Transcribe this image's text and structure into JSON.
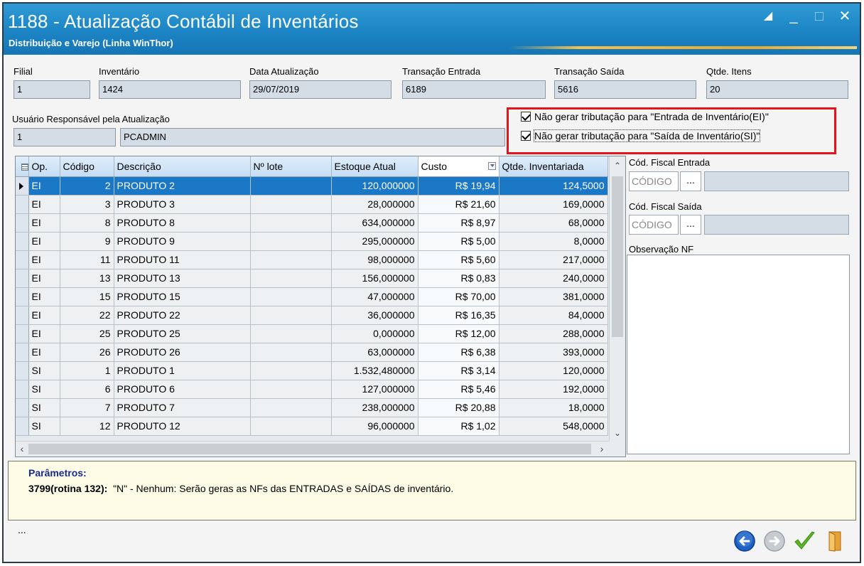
{
  "window": {
    "title": "1188 - Atualização Contábil de Inventários",
    "subtitle": "Distribuição e Varejo (Linha WinThor)",
    "controls": [
      "restore",
      "minimize",
      "maximize",
      "close"
    ]
  },
  "header_fields": {
    "filial": {
      "label": "Filial",
      "value": "1"
    },
    "inventario": {
      "label": "Inventário",
      "value": "1424"
    },
    "data_atualizacao": {
      "label": "Data Atualização",
      "value": "29/07/2019"
    },
    "transacao_entrada": {
      "label": "Transação Entrada",
      "value": "6189"
    },
    "transacao_saida": {
      "label": "Transação Saída",
      "value": "5616"
    },
    "qtde_itens": {
      "label": "Qtde. Itens",
      "value": "20"
    },
    "usuario": {
      "label": "Usuário Responsável pela Atualização",
      "code": "1",
      "name": "PCADMIN"
    }
  },
  "options": {
    "nao_gerar_ei": {
      "label": "Não gerar tributação para \"Entrada de Inventário(EI)\"",
      "checked": true
    },
    "nao_gerar_si": {
      "label": "Não gerar tributação para \"Saída de Inventário(SI)\"",
      "checked": true
    }
  },
  "grid": {
    "columns": [
      "Op.",
      "Código",
      "Descrição",
      "Nº lote",
      "Estoque Atual",
      "Custo",
      "Qtde. Inventariada"
    ],
    "rows": [
      {
        "op": "EI",
        "codigo": "2",
        "descricao": "PRODUTO 2",
        "lote": "",
        "estoque": "120,000000",
        "custo": "R$ 19,94",
        "qtde": "124,5000",
        "selected": true
      },
      {
        "op": "EI",
        "codigo": "3",
        "descricao": "PRODUTO 3",
        "lote": "",
        "estoque": "28,000000",
        "custo": "R$ 21,60",
        "qtde": "169,0000"
      },
      {
        "op": "EI",
        "codigo": "8",
        "descricao": "PRODUTO 8",
        "lote": "",
        "estoque": "634,000000",
        "custo": "R$ 8,97",
        "qtde": "68,0000"
      },
      {
        "op": "EI",
        "codigo": "9",
        "descricao": "PRODUTO 9",
        "lote": "",
        "estoque": "295,000000",
        "custo": "R$ 5,00",
        "qtde": "8,0000"
      },
      {
        "op": "EI",
        "codigo": "11",
        "descricao": "PRODUTO 11",
        "lote": "",
        "estoque": "98,000000",
        "custo": "R$ 5,60",
        "qtde": "217,0000"
      },
      {
        "op": "EI",
        "codigo": "13",
        "descricao": "PRODUTO 13",
        "lote": "",
        "estoque": "156,000000",
        "custo": "R$ 0,83",
        "qtde": "240,0000"
      },
      {
        "op": "EI",
        "codigo": "15",
        "descricao": "PRODUTO 15",
        "lote": "",
        "estoque": "47,000000",
        "custo": "R$ 70,00",
        "qtde": "381,0000"
      },
      {
        "op": "EI",
        "codigo": "22",
        "descricao": "PRODUTO 22",
        "lote": "",
        "estoque": "36,000000",
        "custo": "R$ 16,35",
        "qtde": "84,0000"
      },
      {
        "op": "EI",
        "codigo": "25",
        "descricao": "PRODUTO 25",
        "lote": "",
        "estoque": "0,000000",
        "custo": "R$ 12,00",
        "qtde": "288,0000"
      },
      {
        "op": "EI",
        "codigo": "26",
        "descricao": "PRODUTO 26",
        "lote": "",
        "estoque": "63,000000",
        "custo": "R$ 6,38",
        "qtde": "393,0000"
      },
      {
        "op": "SI",
        "codigo": "1",
        "descricao": "PRODUTO 1",
        "lote": "",
        "estoque": "1.532,480000",
        "custo": "R$ 3,14",
        "qtde": "120,0000"
      },
      {
        "op": "SI",
        "codigo": "6",
        "descricao": "PRODUTO 6",
        "lote": "",
        "estoque": "127,000000",
        "custo": "R$ 5,46",
        "qtde": "192,0000"
      },
      {
        "op": "SI",
        "codigo": "7",
        "descricao": "PRODUTO 7",
        "lote": "",
        "estoque": "238,000000",
        "custo": "R$ 20,88",
        "qtde": "18,0000"
      },
      {
        "op": "SI",
        "codigo": "12",
        "descricao": "PRODUTO 12",
        "lote": "",
        "estoque": "96,000000",
        "custo": "R$ 1,02",
        "qtde": "548,0000"
      }
    ]
  },
  "right_panel": {
    "cod_fiscal_entrada": {
      "label": "Cód. Fiscal Entrada",
      "placeholder": "CÓDIGO",
      "button": "..."
    },
    "cod_fiscal_saida": {
      "label": "Cód. Fiscal Saída",
      "placeholder": "CÓDIGO",
      "button": "..."
    },
    "observacao": {
      "label": "Observação NF",
      "value": ""
    }
  },
  "params": {
    "title": "Parâmetros:",
    "code": "3799(rotina 132):",
    "text": "\"N\" - Nenhum: Serão geras as NFs das ENTRADAS e SAÍDAS de inventário."
  },
  "footer": {
    "status": "...",
    "icons": [
      "back-icon",
      "forward-icon",
      "confirm-icon",
      "exit-icon"
    ]
  },
  "colors": {
    "titlebar": "#1c84c4",
    "selection": "#1a78c6",
    "highlight_border": "#e3141c",
    "params_bg": "#fbfbe6"
  }
}
